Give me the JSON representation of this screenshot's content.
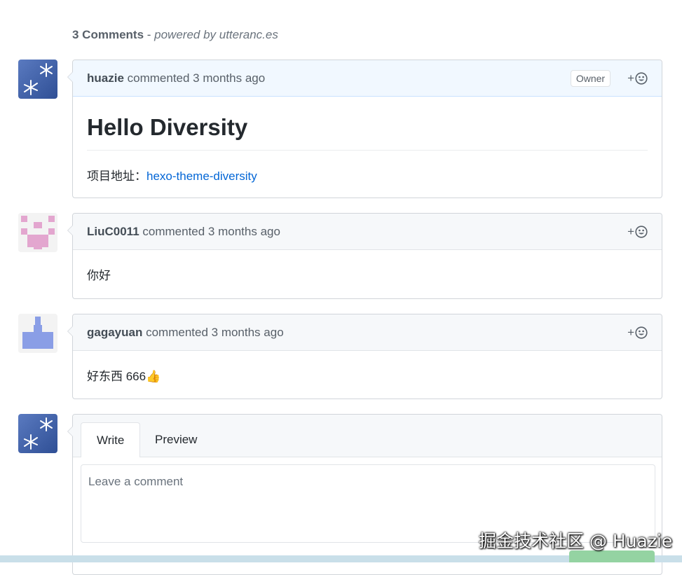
{
  "header": {
    "count": "3 Comments",
    "separator": " - ",
    "powered": "powered by utteranc.es"
  },
  "comments": [
    {
      "author": "huazie",
      "meta": "commented 3 months ago",
      "badge": "Owner",
      "reaction": "+",
      "title": "Hello Diversity",
      "project_label": "项目地址：",
      "project_link": "hexo-theme-diversity"
    },
    {
      "author": "LiuC0011",
      "meta": "commented 3 months ago",
      "reaction": "+",
      "body": "你好"
    },
    {
      "author": "gagayuan",
      "meta": "commented 3 months ago",
      "reaction": "+",
      "body": "好东西 666👍"
    }
  ],
  "form": {
    "tab_write": "Write",
    "tab_preview": "Preview",
    "placeholder": "Leave a comment"
  },
  "watermark": "掘金技术社区 @ Huazie",
  "colors": {
    "link": "#0366d6",
    "owner_header": "#f1f8ff",
    "header_bg": "#f6f8fa",
    "identicon_pink": "#e3a6cf",
    "identicon_blue": "#8a9ee6"
  },
  "icons": {
    "reaction": "smiley-icon",
    "avatar_owner": "starfish-avatar"
  }
}
